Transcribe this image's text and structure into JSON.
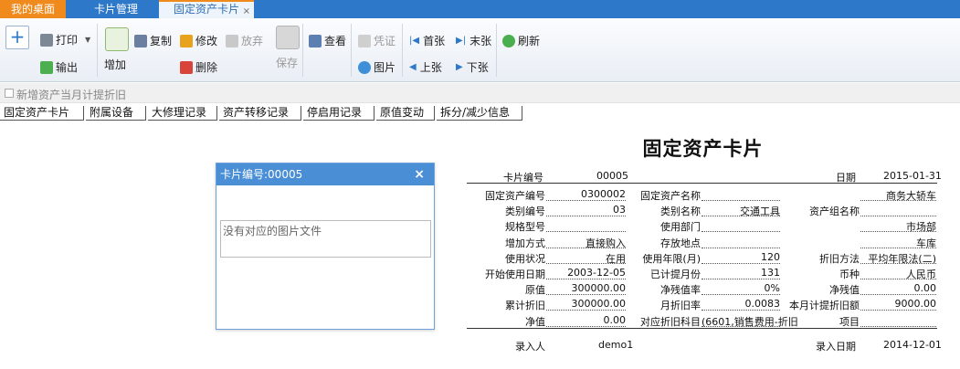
{
  "tabs": {
    "home": "我的桌面",
    "cards": "卡片管理",
    "active": "固定资产卡片",
    "close": "×"
  },
  "toolbar": {
    "print": "打印",
    "export": "输出",
    "add": "增加",
    "copy": "复制",
    "edit": "修改",
    "discard": "放弃",
    "delete": "删除",
    "save": "保存",
    "view": "查看",
    "voucher": "凭证",
    "picture": "图片",
    "first": "首张",
    "prev": "上张",
    "last": "末张",
    "next": "下张",
    "refresh": "刷新"
  },
  "checkbox": {
    "label": "新增资产当月计提折旧"
  },
  "subtabs": [
    "固定资产卡片",
    "附属设备",
    "大修理记录",
    "资产转移记录",
    "停启用记录",
    "原值变动",
    "拆分/减少信息"
  ],
  "dialog": {
    "title": "卡片编号:00005",
    "close": "×",
    "message": "没有对应的图片文件"
  },
  "card": {
    "title": "固定资产卡片",
    "card_no_label": "卡片编号",
    "card_no": "00005",
    "date_label": "日期",
    "date": "2015-01-31",
    "rows": [
      {
        "l1": "固定资产编号",
        "v1": "0300002",
        "l2": "固定资产名称",
        "v2": "",
        "l3": "",
        "v3": "商务大轿车"
      },
      {
        "l1": "类别编号",
        "v1": "03",
        "l2": "类别名称",
        "v2": "交通工具",
        "l3": "资产组名称",
        "v3": ""
      },
      {
        "l1": "规格型号",
        "v1": "",
        "l2": "使用部门",
        "v2": "",
        "l3": "",
        "v3": "市场部"
      },
      {
        "l1": "增加方式",
        "v1": "直接购入",
        "l2": "存放地点",
        "v2": "",
        "l3": "",
        "v3": "车库"
      },
      {
        "l1": "使用状况",
        "v1": "在用",
        "l2": "使用年限(月)",
        "v2": "120",
        "l3": "折旧方法",
        "v3": "平均年限法(二)"
      },
      {
        "l1": "开始使用日期",
        "v1": "2003-12-05",
        "l2": "已计提月份",
        "v2": "131",
        "l3": "币种",
        "v3": "人民币"
      },
      {
        "l1": "原值",
        "v1": "300000.00",
        "l2": "净残值率",
        "v2": "0%",
        "l3": "净残值",
        "v3": "0.00"
      },
      {
        "l1": "累计折旧",
        "v1": "300000.00",
        "l2": "月折旧率",
        "v2": "0.0083",
        "l3": "本月计提折旧额",
        "v3": "9000.00"
      },
      {
        "l1": "净值",
        "v1": "0.00",
        "l2": "对应折旧科目",
        "v2": "(6601,销售费用-折旧",
        "l3": "项目",
        "v3": ""
      }
    ],
    "entered_by_label": "录入人",
    "entered_by": "demo1",
    "entry_date_label": "录入日期",
    "entry_date": "2014-12-01"
  }
}
